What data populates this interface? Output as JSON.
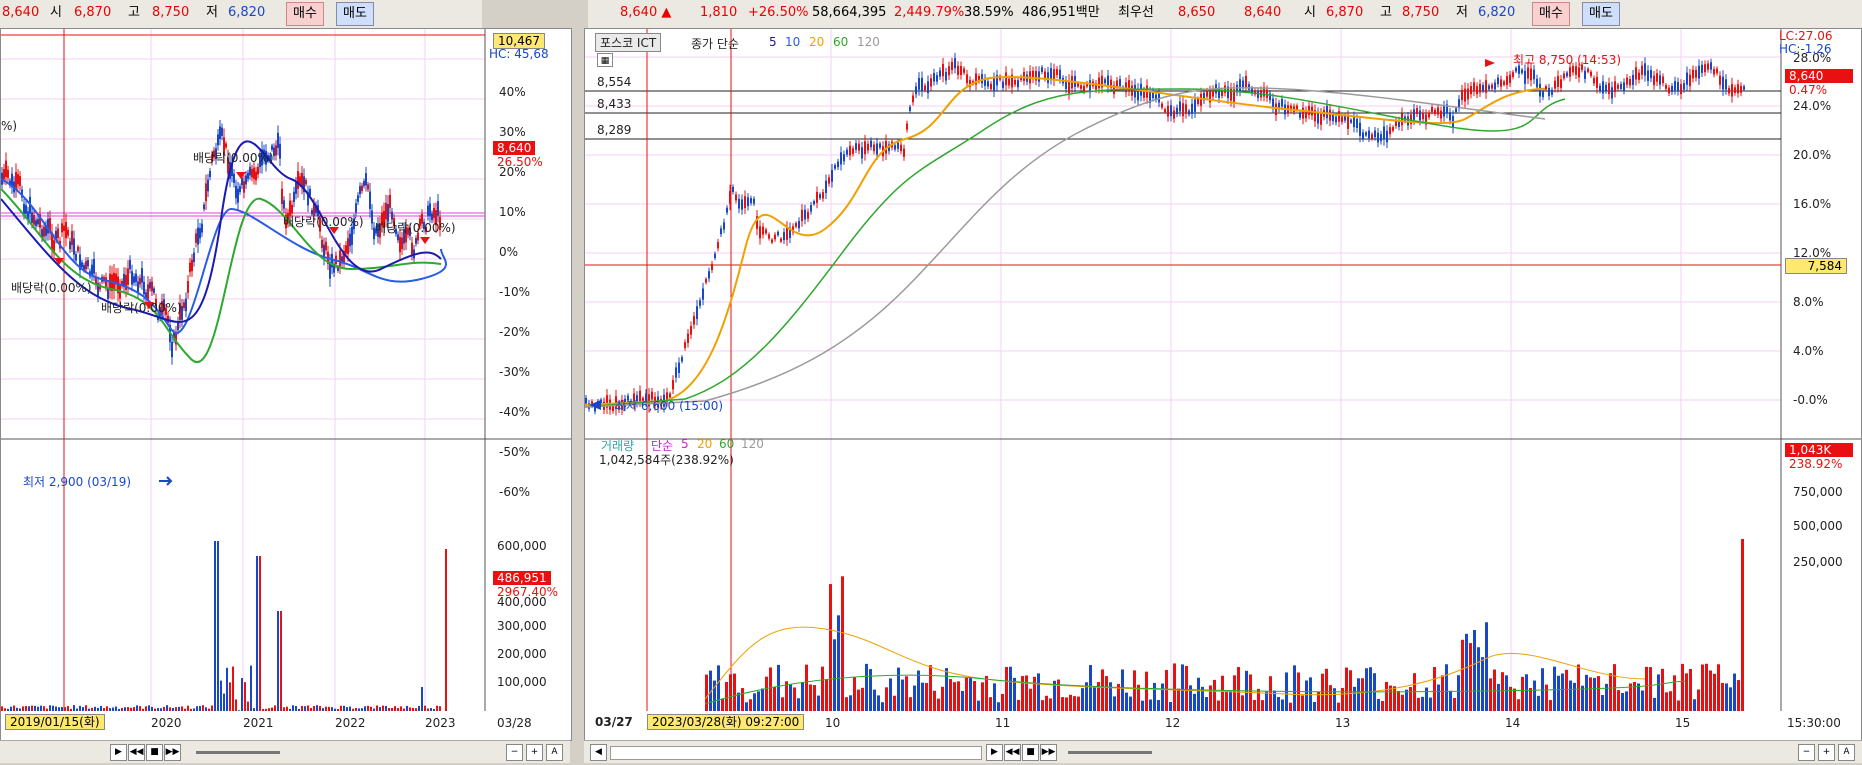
{
  "left_toolbar": {
    "price": "8,640",
    "open_label": "시",
    "open": "6,870",
    "high_label": "고",
    "high": "8,750",
    "low_label": "저",
    "low": "6,820",
    "buy": "매수",
    "sell": "매도"
  },
  "right_toolbar": {
    "price": "8,640",
    "change": "1,810",
    "change_pct": "+26.50%",
    "volume": "58,664,395",
    "volume_ratio": "2,449.79%",
    "turnover": "38.59%",
    "amount": "486,951백만",
    "best_label": "최우선",
    "ask": "8,650",
    "bid": "8,640",
    "open_label": "시",
    "open": "6,870",
    "high_label": "고",
    "high": "8,750",
    "low_label": "저",
    "low": "6,820",
    "buy": "매수",
    "sell": "매도"
  },
  "left_chart": {
    "top_value_tag": "10,467",
    "hc_label": "HC: 45,68",
    "price_tag": "8,640",
    "price_pct": "26.50%",
    "y_ticks": [
      "40%",
      "30%",
      "20%",
      "10%",
      "0%",
      "-10%",
      "-20%",
      "-30%",
      "-40%",
      "-50%",
      "-60%"
    ],
    "dividends": [
      "배당락(0.00%)",
      "배당락(0.00%)",
      "배당락(0.00%)",
      "배당락(0.00%)",
      "배당락(0.00%)"
    ],
    "left_edge_text": "%)",
    "low_marker": "최저 2,900 (03/19)",
    "volume_ticks": [
      "600,000",
      "400,000",
      "300,000",
      "200,000",
      "100,000"
    ],
    "volume_tag": "486,951",
    "volume_pct": "2967.40%",
    "x_ticks": [
      "2020",
      "2021",
      "2022",
      "2023"
    ],
    "x_start": "2019/01/15(화)",
    "x_end": "03/28"
  },
  "right_chart": {
    "stock_name": "포스코 ICT",
    "ma_label": "종가 단순",
    "ma_periods": [
      "5",
      "10",
      "20",
      "60",
      "120"
    ],
    "lc_label": "LC:27.06",
    "hc_label": "HC:-1.26",
    "high_marker": "최고 8,750 (14:53)",
    "low_marker": "최저 6,600 (15:00)",
    "hlines": [
      "8,554",
      "8,433",
      "8,289"
    ],
    "price_tag": "8,640",
    "price_pct": "0.47%",
    "red_line_tag": "7,584",
    "y_ticks": [
      "28.0%",
      "24.0%",
      "20.0%",
      "16.0%",
      "12.0%",
      "8.0%",
      "4.0%",
      "-0.0%"
    ],
    "volume_title": "거래량",
    "volume_ma_label": "단순",
    "volume_ma_periods": [
      "5",
      "20",
      "60",
      "120"
    ],
    "volume_readout": "1,042,584주(238.92%)",
    "volume_tag": "1,043K",
    "volume_pct": "238.92%",
    "volume_ticks": [
      "750,000",
      "500,000",
      "250,000"
    ],
    "x_ticks": [
      "10",
      "11",
      "12",
      "13",
      "14",
      "15"
    ],
    "x_start": "03/27",
    "cursor_time": "2023/03/28(화) 09:27:00",
    "x_end": "15:30:00"
  },
  "colors": {
    "up": "#e81010",
    "down": "#1848c8",
    "ma5": "#1c1c8c",
    "ma10": "#2a5be8",
    "ma20": "#f0a000",
    "ma60": "#2ea82e",
    "ma120": "#9a9a9a"
  }
}
